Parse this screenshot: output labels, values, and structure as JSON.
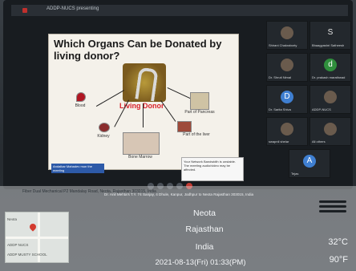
{
  "window": {
    "title": "ADDP-NUCS presenting"
  },
  "slide": {
    "title": "Which Organs Can be Donated by living donor?",
    "center_label": "Living Donor",
    "organs": [
      "Blood",
      "Kidney",
      "Part of Pancreas",
      "Bone Marrow",
      "Part of the liver"
    ]
  },
  "caption": {
    "text": "Andalkar Mahadev mun the meeting"
  },
  "popup": {
    "text": "Your Network Bandwidth is unstable. The meeting audio/video may be affected."
  },
  "participants": [
    {
      "name": "Shirani Chakraborty",
      "avatar": ""
    },
    {
      "name": "Bhaagyashri Satheesh",
      "avatar": "S"
    },
    {
      "name": "Dr. Shruti Nimal",
      "avatar": ""
    },
    {
      "name": "Dr. prakash marathwad",
      "avatar": "d"
    },
    {
      "name": "Dr. Sarita Shiva",
      "avatar": "D"
    },
    {
      "name": "ADDP-NUCS",
      "avatar": ""
    },
    {
      "name": "swapnil shelar",
      "avatar": ""
    },
    {
      "name": "All others",
      "avatar": ""
    },
    {
      "name": "Tejas",
      "avatar": "A"
    }
  ],
  "stamp": {
    "header": "Fiber Dual Mechanical P2 Mandalay Road, Neota, Rajasthan 303015, India",
    "subheader": "Dr. Anil Mehta's T.Y. 74 Sanjay, 4 Dhule, Kanpur, Jodhpur to Neota Rajasthan 303015, India",
    "city": "Neota",
    "state": "Rajasthan",
    "country": "India",
    "temp_c": "32°C",
    "temp_f": "90°F",
    "datetime": "2021-08-13(Fri)  01:33(PM)",
    "map_labels": [
      "Neota",
      "ADDP NUCS",
      "ADDP MUSTY SCHOOL"
    ]
  },
  "colors": {
    "accent": "#d8222b",
    "blue": "#2d5aa8"
  }
}
